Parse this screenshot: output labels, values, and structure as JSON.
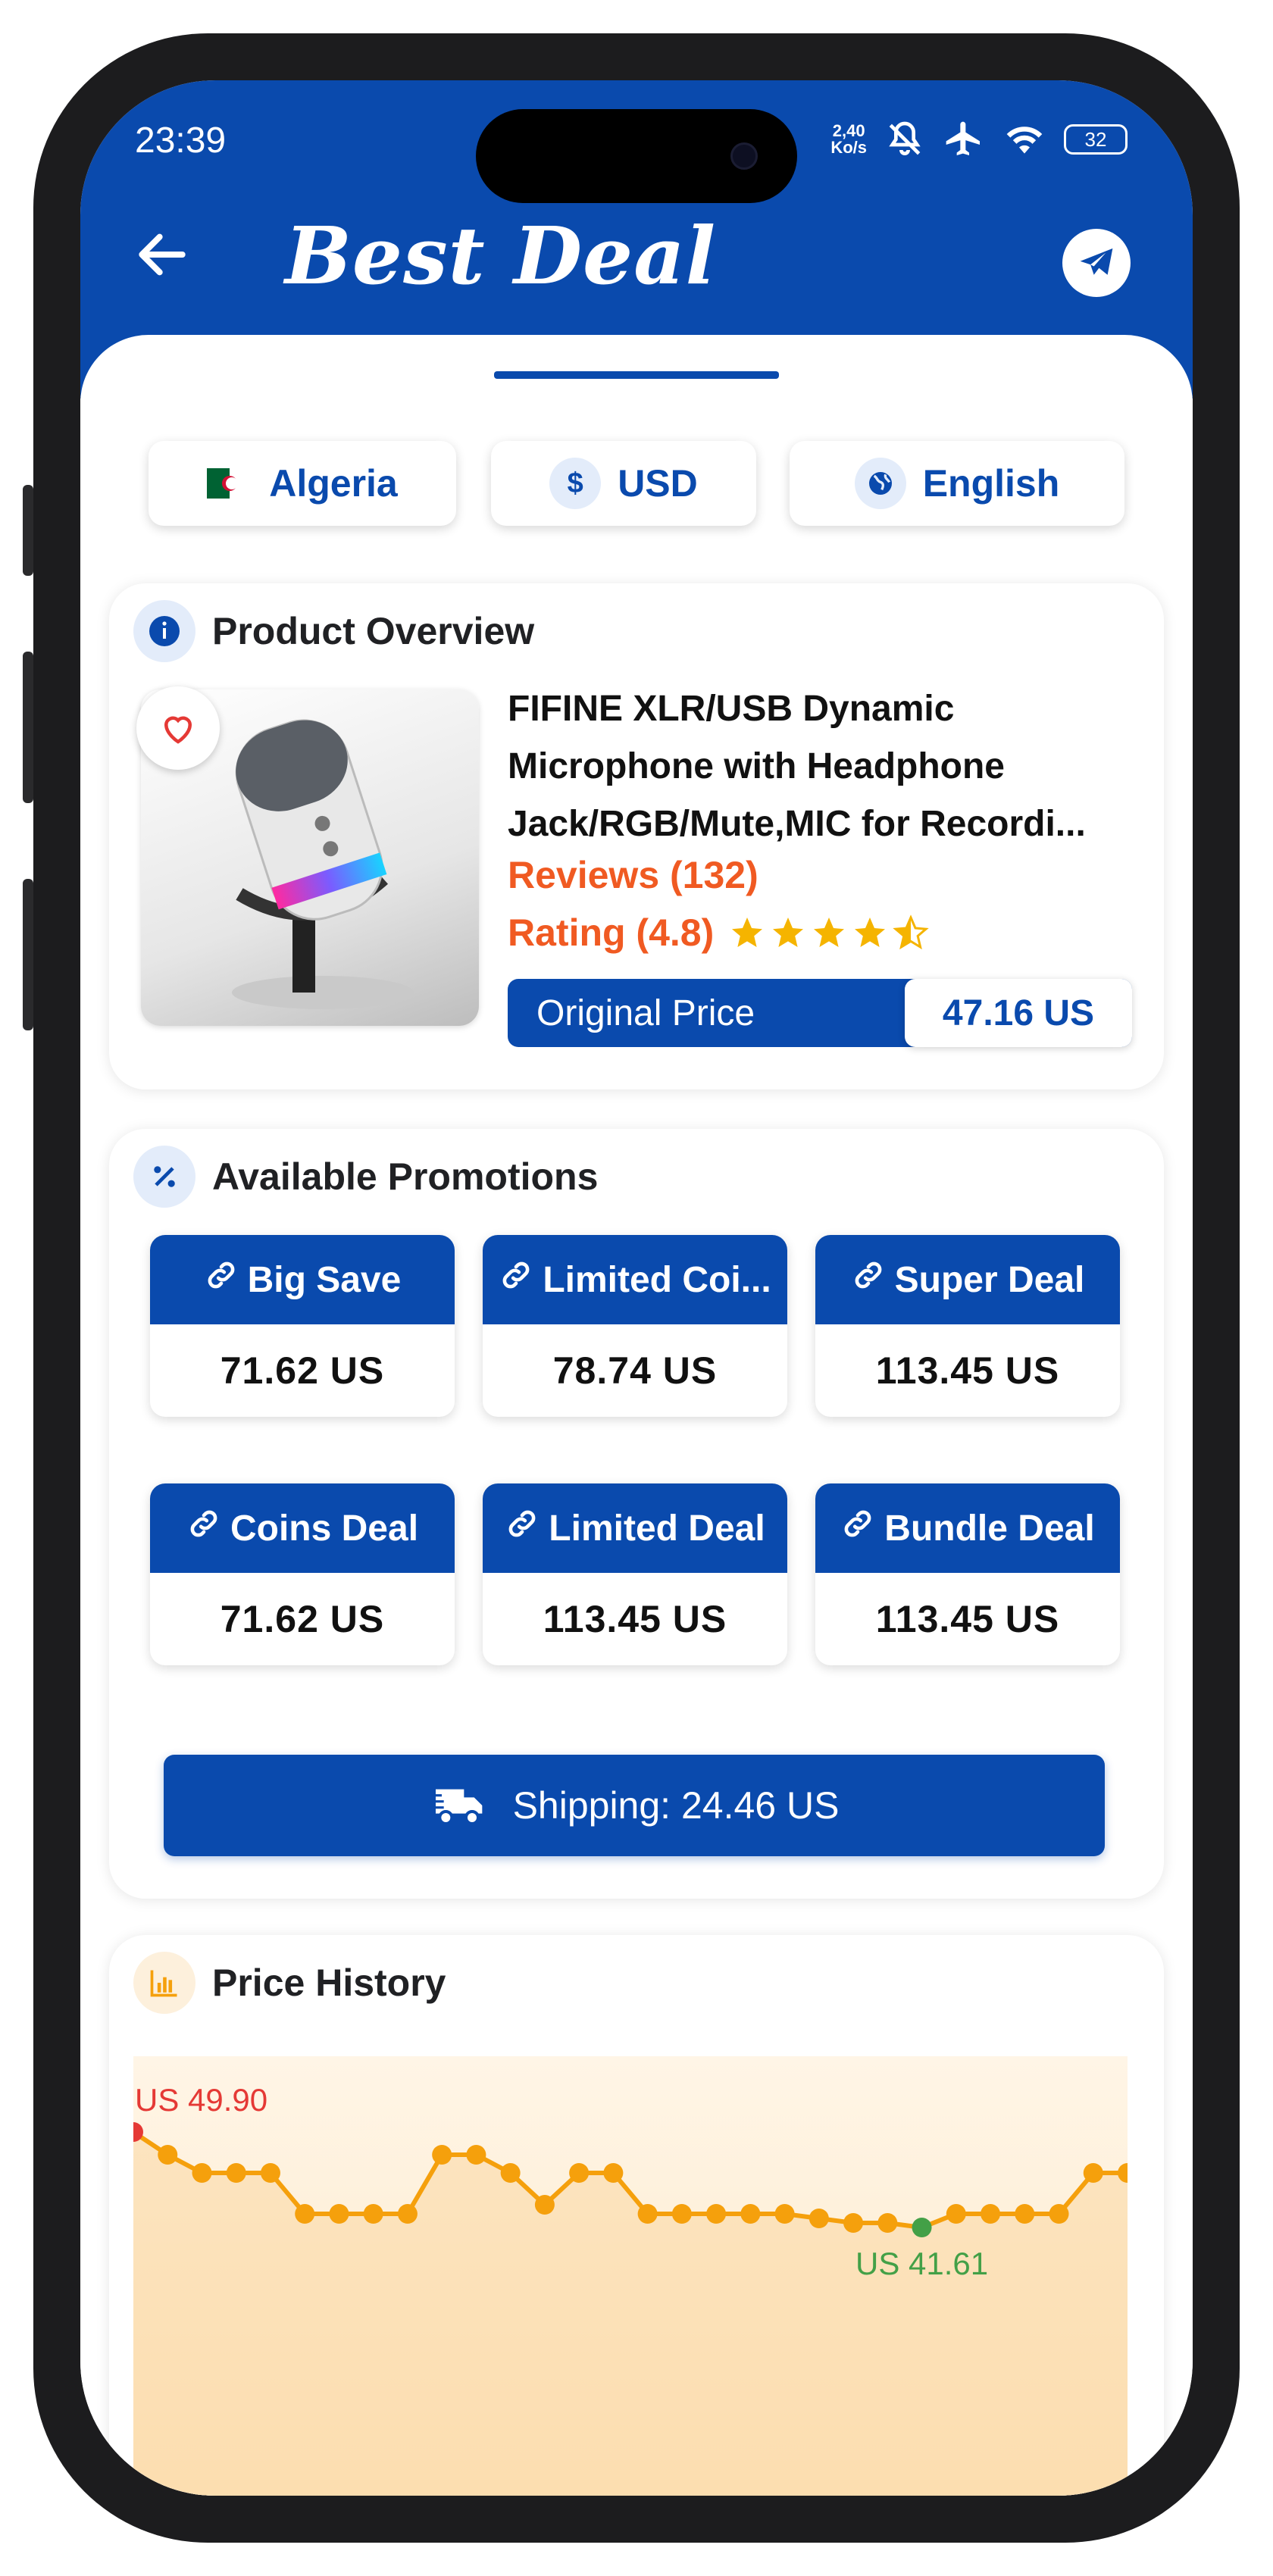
{
  "status_bar": {
    "time": "23:39",
    "net_speed_top": "2,40",
    "net_speed_bottom": "Ko/s",
    "battery": "32"
  },
  "header": {
    "title": "Best Deal"
  },
  "selectors": {
    "country": "Algeria",
    "currency": "USD",
    "language": "English"
  },
  "overview": {
    "heading": "Product Overview",
    "product_name": "FIFINE XLR/USB Dynamic Microphone with Headphone Jack/RGB/Mute,MIC for Recordi...",
    "reviews": "Reviews (132)",
    "rating": "Rating (4.8)",
    "rating_value": 4.8,
    "original_price_label": "Original Price",
    "original_price": "47.16 US"
  },
  "promotions": {
    "heading": "Available Promotions",
    "items": [
      {
        "label": "Big Save",
        "value": "71.62 US"
      },
      {
        "label": "Limited Coi...",
        "value": "78.74 US"
      },
      {
        "label": "Super Deal",
        "value": "113.45 US"
      },
      {
        "label": "Coins Deal",
        "value": "71.62 US"
      },
      {
        "label": "Limited Deal",
        "value": "113.45 US"
      },
      {
        "label": "Bundle Deal",
        "value": "113.45 US"
      }
    ],
    "shipping": "Shipping: 24.46 US"
  },
  "price_history": {
    "heading": "Price History",
    "max_label": "US 49.90",
    "min_label": "US 41.61"
  },
  "colors": {
    "primary": "#0a4aad",
    "accent": "#f05a22",
    "max_point": "#e53935",
    "min_point": "#43a047",
    "line": "#f5a00c"
  },
  "chart_data": {
    "type": "line",
    "title": "",
    "xlabel": "",
    "ylabel": "",
    "ylim": [
      40,
      51
    ],
    "series": [
      {
        "values": [
          49.9,
          49.4,
          49.0,
          49.0,
          49.0,
          48.1,
          48.1,
          48.1,
          48.1,
          49.4,
          49.4,
          49.0,
          48.3,
          49.0,
          49.0,
          48.1,
          48.1,
          48.1,
          48.1,
          48.1,
          48.0,
          47.9,
          47.9,
          41.61,
          48.1,
          48.1,
          48.1,
          48.1,
          49.0,
          49.0
        ]
      }
    ],
    "max": {
      "label": "US 49.90",
      "value": 49.9
    },
    "min": {
      "label": "US 41.61",
      "value": 41.61
    }
  }
}
